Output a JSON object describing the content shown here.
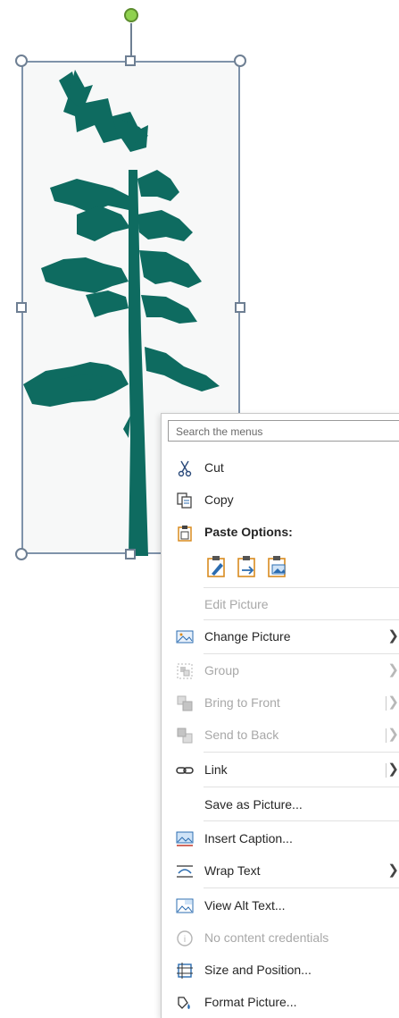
{
  "search": {
    "placeholder": "Search the menus"
  },
  "menu": {
    "cut": "Cut",
    "copy": "Copy",
    "paste_options": "Paste Options:",
    "edit_picture": "Edit Picture",
    "change_picture": "Change Picture",
    "group": "Group",
    "bring_to_front": "Bring to Front",
    "send_to_back": "Send to Back",
    "link": "Link",
    "save_as_picture": "Save as Picture...",
    "insert_caption": "Insert Caption...",
    "wrap_text": "Wrap Text",
    "view_alt_text": "View Alt Text...",
    "no_content_credentials": "No content credentials",
    "size_and_position": "Size and Position...",
    "format_picture": "Format Picture..."
  },
  "colors": {
    "tree": "#0e6b60",
    "selection_border": "#7f93aa",
    "rotate_handle": "#8fd14f",
    "disabled_text": "#a8a8a8",
    "accent_icon": "#2b6cb0",
    "paste_orange": "#d98b1f"
  }
}
